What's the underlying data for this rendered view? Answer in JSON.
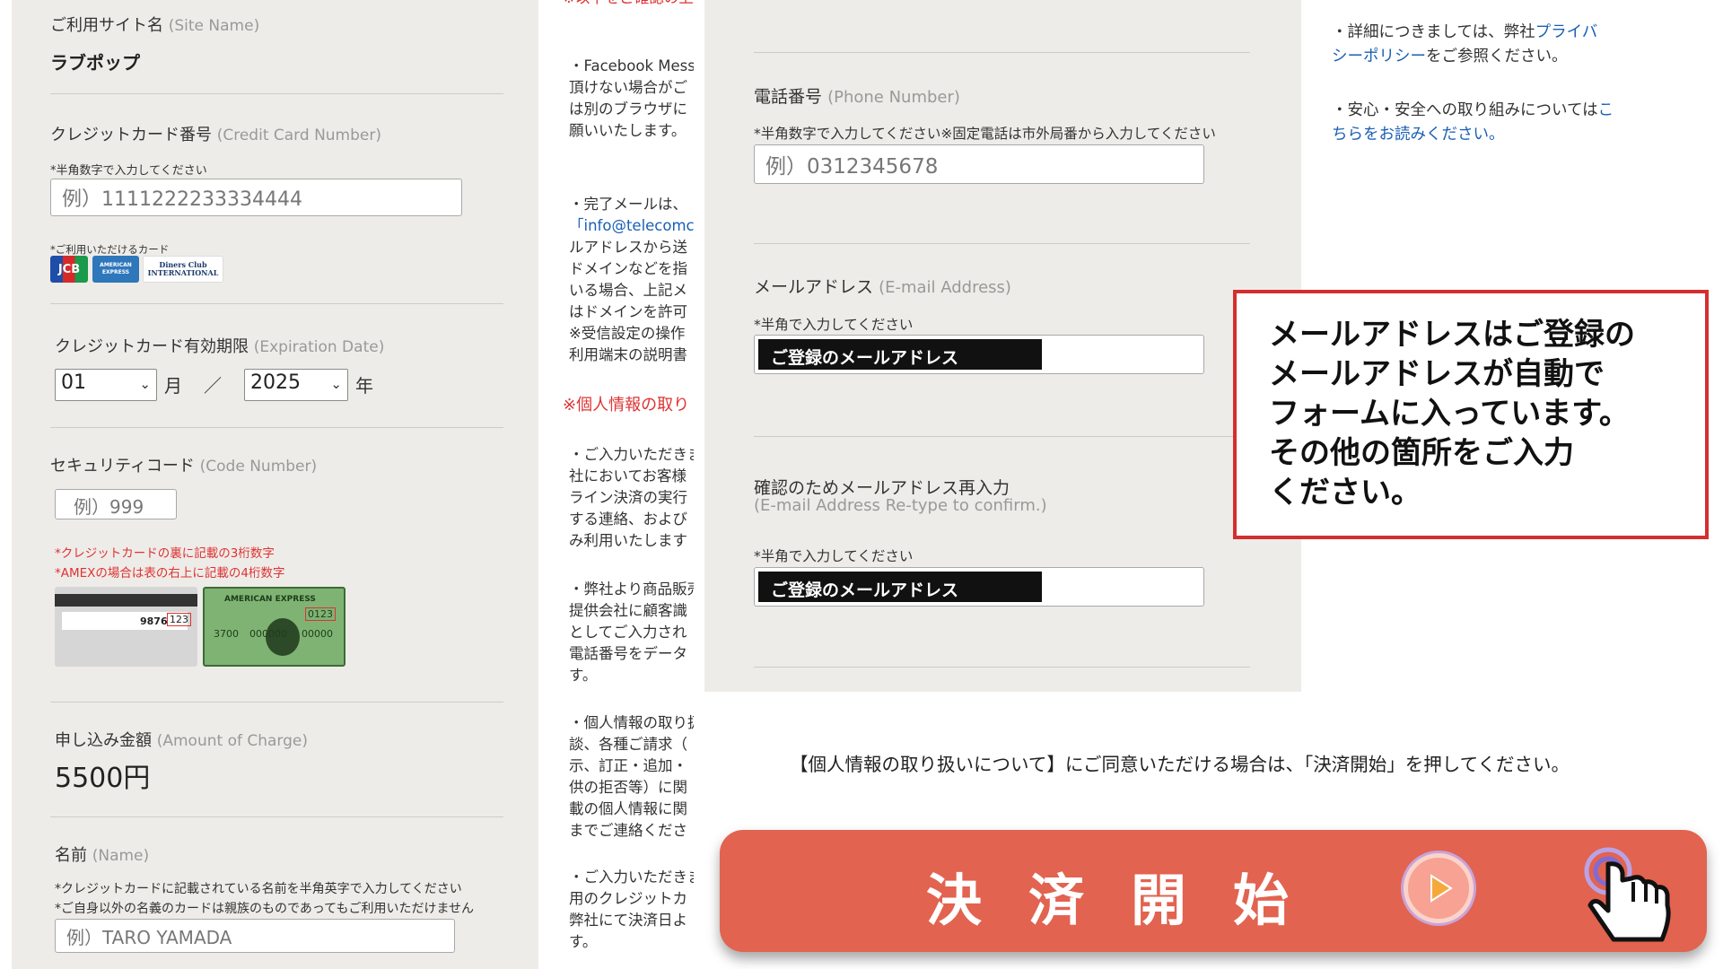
{
  "site_name": {
    "label_jp": "ご利用サイト名",
    "label_en": "(Site Name)",
    "value": "ラブポップ"
  },
  "card_number": {
    "label_jp": "クレジットカード番号",
    "label_en": "(Credit Card Number)",
    "note": "*半角数字で入力してください",
    "placeholder": "例）1111222233334444"
  },
  "accepted_cards": {
    "note": "*ご利用いただけるカード",
    "logos": [
      "JCB",
      "AMERICAN EXPRESS",
      "Diners Club INTERNATIONAL"
    ]
  },
  "expiration": {
    "label_jp": "クレジットカード有効期限",
    "label_en": "(Expiration Date)",
    "month": "01",
    "month_unit": "月",
    "separator": "／",
    "year": "2025",
    "year_unit": "年"
  },
  "security_code": {
    "label_jp": "セキュリティコード",
    "label_en": "(Code Number)",
    "placeholder": "例）999",
    "note1": "*クレジットカードの裏に記載の3桁数字",
    "note2": "*AMEXの場合は表の右上に記載の4桁数字",
    "card_back_num": "9876",
    "card_back_code": "123",
    "amex_title": "AMERICAN EXPRESS",
    "amex_code": "0123",
    "amex_num1": "3700",
    "amex_num2": "000000",
    "amex_num3": "00000"
  },
  "amount": {
    "label_jp": "申し込み金額",
    "label_en": "(Amount of Charge)",
    "value": "5500円"
  },
  "name": {
    "label_jp": "名前",
    "label_en": "(Name)",
    "note1": "*クレジットカードに記載されている名前を半角英字で入力してください",
    "note2": "*ご自身以外の名義のカードは親族のものであってもご利用いただけません",
    "placeholder": "例）TARO YAMADA"
  },
  "middle_notes": {
    "top_red": "※以下をご確認の上ご入力",
    "b1": [
      "・Facebook Mess",
      "頂けない場合がご",
      "は別のブラウザに",
      "願いいたします。"
    ],
    "b2": [
      "・完了メールは、",
      "「info@telecomc",
      "ルアドレスから送",
      "ドメインなどを指",
      "いる場合、上記メ",
      "はドメインを許可",
      "※受信設定の操作",
      "利用端末の説明書"
    ],
    "red_heading": "※個人情報の取り",
    "b3": [
      "・ご入力いただきま",
      "社においてお客様",
      "ライン決済の実行",
      "する連絡、および",
      "み利用いたします"
    ],
    "b4": [
      "・弊社より商品販売",
      "提供会社に顧客識",
      "としてご入力され",
      "電話番号をデータ",
      "す。"
    ],
    "b5": [
      "・個人情報の取り扱",
      "談、各種ご請求（",
      "示、訂正・追加・",
      "供の拒否等）に関",
      "載の個人情報に関",
      "までご連絡くださ"
    ],
    "b6": [
      "・ご入力いただきま",
      "用のクレジットカ",
      "弊社にて決済日よ",
      "す。"
    ]
  },
  "phone": {
    "label_jp": "電話番号",
    "label_en": "(Phone Number)",
    "note": "*半角数字で入力してください※固定電話は市外局番から入力してください",
    "placeholder": "例）0312345678"
  },
  "email": {
    "label_jp": "メールアドレス",
    "label_en": "(E-mail Address)",
    "note": "*半角で入力してください",
    "value": "ご登録のメールアドレス"
  },
  "email_confirm": {
    "label_jp": "確認のためメールアドレス再入力",
    "label_en": "(E-mail Address Re-type to confirm.)",
    "note": "*半角で入力してください",
    "value": "ご登録のメールアドレス"
  },
  "side_notes": {
    "p1_a": "・詳細につきましては、弊社",
    "p1_link1": "プライバ",
    "p1_link2": "シーポリシー",
    "p1_b": "をご参照ください。",
    "p2_a": "・安心・安全への取り組みについては",
    "p2_link1": "こ",
    "p2_link2": "ちらをお読みください。"
  },
  "callout": {
    "lines": [
      "メールアドレスはご登録の",
      "メールアドレスが自動で",
      "フォームに入っています。",
      "その他の箇所をご入力",
      "ください。"
    ]
  },
  "consent": "【個人情報の取り扱いについて】にご同意いただける場合は、「決済開始」を押してください。",
  "pay_button": {
    "label": "決済開始"
  },
  "colors": {
    "panel_bg": "#eeece8",
    "callout_border": "#d32f2f",
    "button_bg": "#e2634f",
    "link": "#1a5fb4",
    "warning": "#dd3333"
  }
}
